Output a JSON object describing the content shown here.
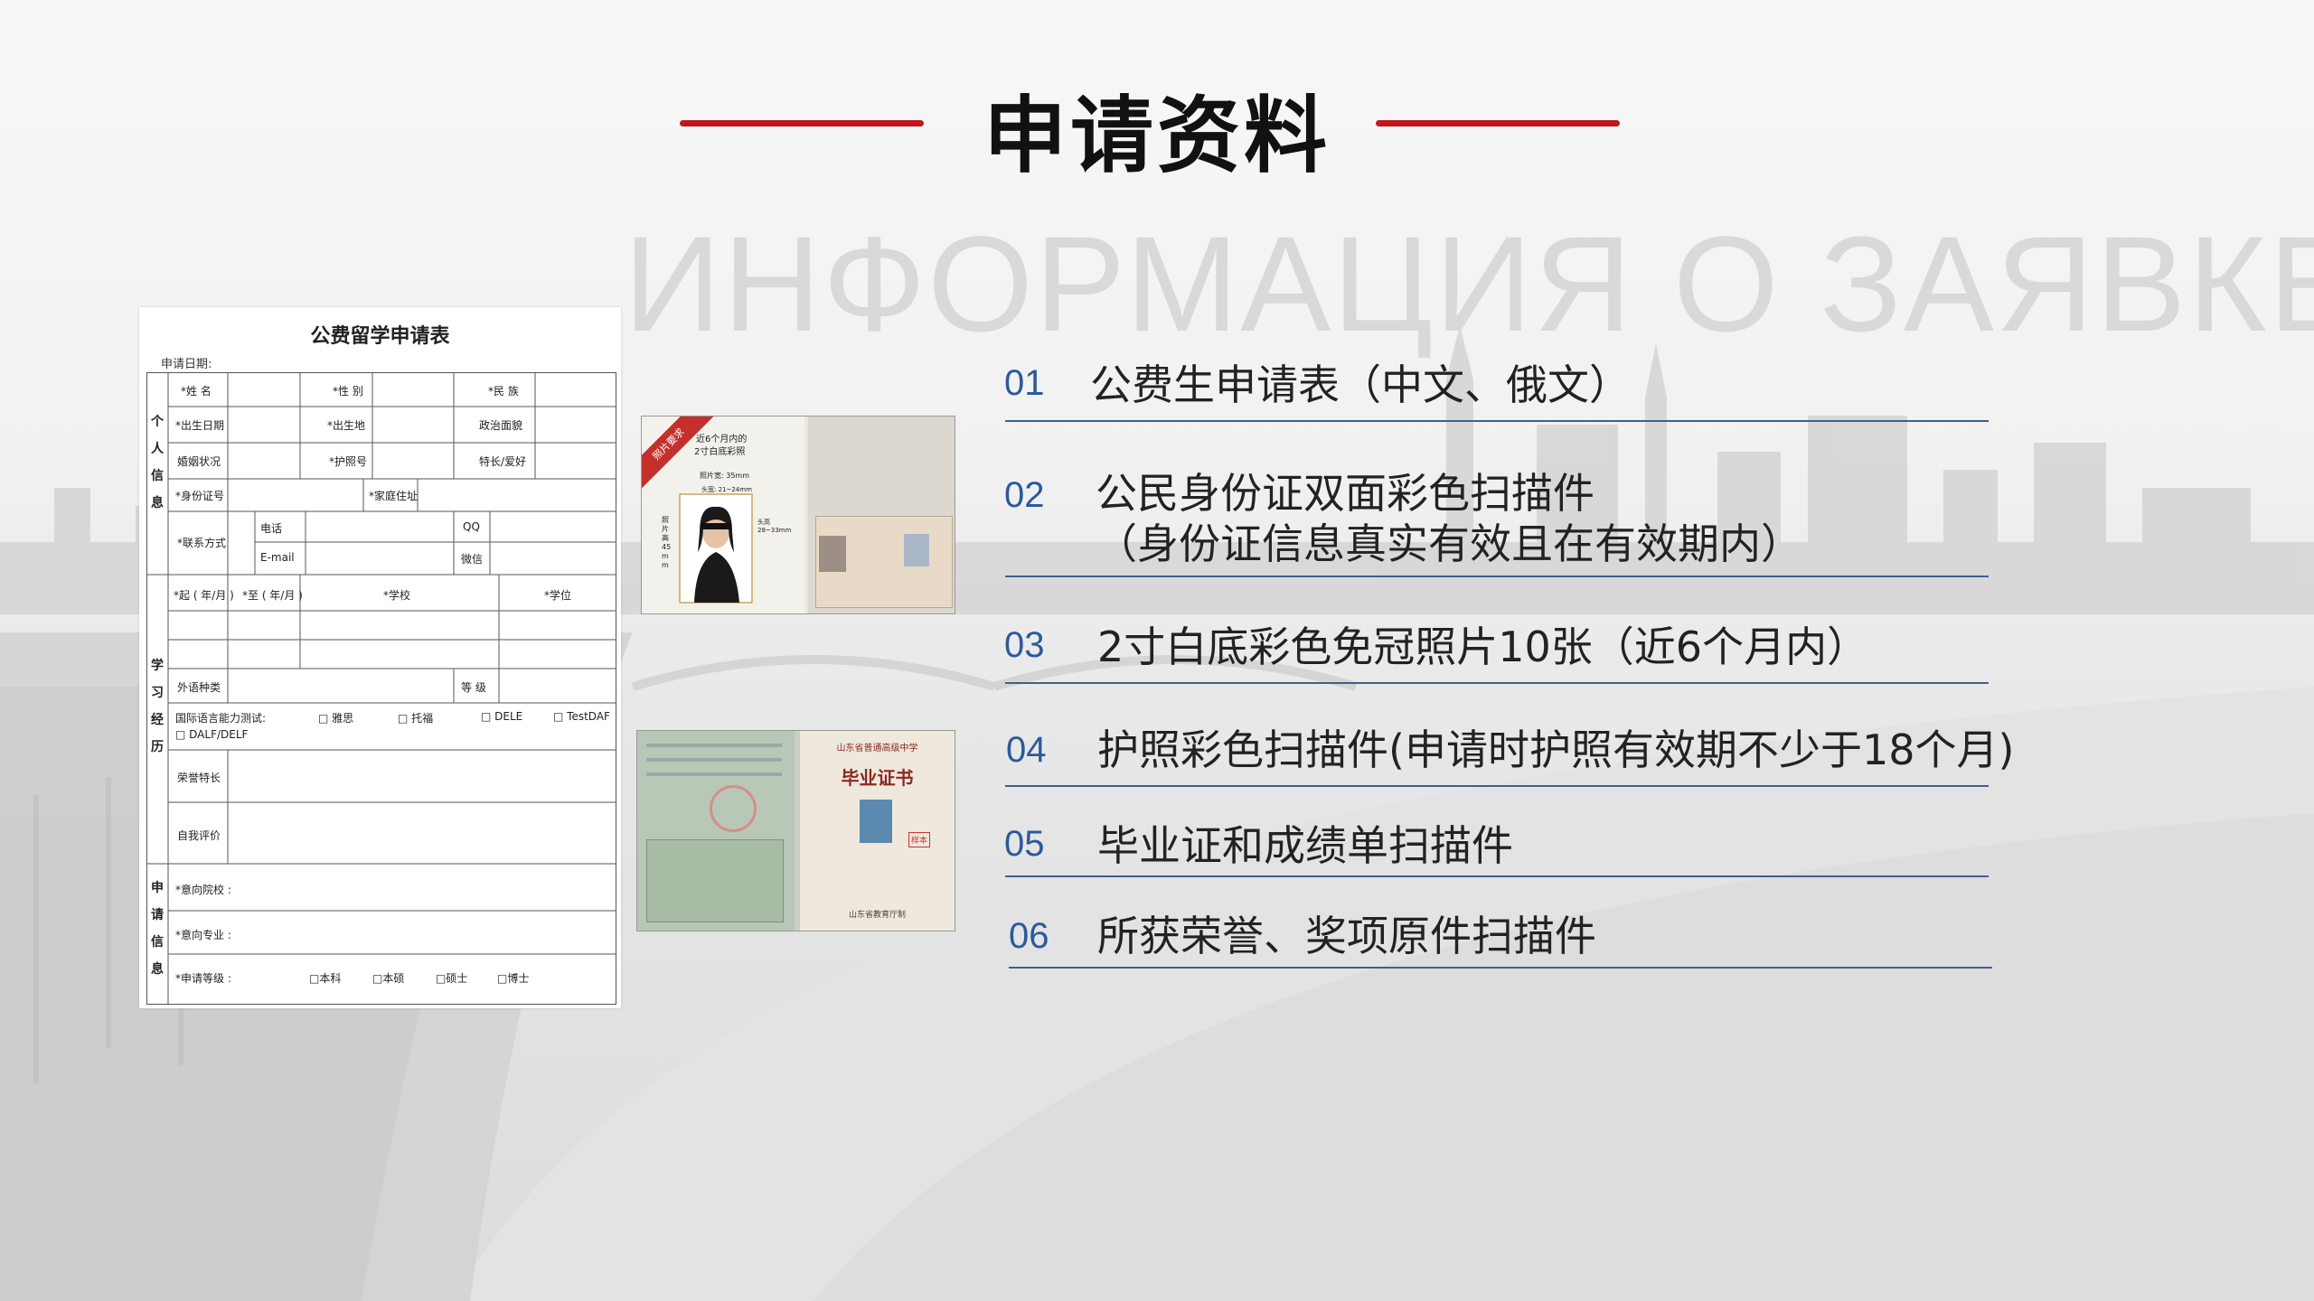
{
  "slide": {
    "title": "申请资料",
    "background_text": "ИНФОРМАЦИЯ О ЗАЯВКЕ"
  },
  "colors": {
    "accent": "#c0161c",
    "number": "#2b5a9c",
    "separator": "#3d5f8f"
  },
  "form": {
    "title": "公费留学申请表",
    "date_label": "申请日期:",
    "sections": [
      "个人信息",
      "学习经历",
      "申请信息"
    ],
    "personal": {
      "name": "*姓 名",
      "gender": "*性 别",
      "ethnicity": "*民 族",
      "birth_date": "*出生日期",
      "birthplace": "*出生地",
      "political": "政治面貌",
      "marital": "婚姻状况",
      "passport": "*护照号",
      "hobby": "特长/爱好",
      "id_number": "*身份证号",
      "address": "*家庭住址",
      "contact": "*联系方式",
      "phone": "电话",
      "qq": "QQ",
      "email": "E-mail",
      "wechat": "微信"
    },
    "study": {
      "from": "*起 ( 年/月 )",
      "to": "*至 ( 年/月 )",
      "school": "*学校",
      "degree": "*学位",
      "language": "外语种类",
      "level": "等 级",
      "test_label": "国际语言能力测试:",
      "tests": [
        "□ 雅思",
        "□ 托福",
        "□ DELE",
        "□ TestDAF",
        "□ DALF/DELF"
      ],
      "honors": "荣誉特长",
      "self_eval": "自我评价"
    },
    "apply": {
      "school": "*意向院校 :",
      "major": "*意向专业 :",
      "level": "*申请等级 :",
      "options": [
        "□本科",
        "□本硕",
        "□硕士",
        "□博士"
      ]
    }
  },
  "photo1": {
    "ribbon": "照片要求",
    "caption1": "近6个月内的",
    "caption2": "2寸白底彩照",
    "width_label": "照片宽: 35mm",
    "face_width": "头宽: 21~24mm",
    "height_label": "照片高45mm",
    "head_height": "头高 28~33mm"
  },
  "photo2": {
    "school": "山东省普通高级中学",
    "cert": "毕业证书",
    "stamp": "样本",
    "issuer": "山东省教育厅制"
  },
  "items": [
    {
      "num": "01",
      "lines": [
        "公费生申请表（中文、俄文）"
      ]
    },
    {
      "num": "02",
      "lines": [
        "公民身份证双面彩色扫描件",
        "（身份证信息真实有效且在有效期内）"
      ]
    },
    {
      "num": "03",
      "lines": [
        "2寸白底彩色免冠照片10张（近6个月内）"
      ]
    },
    {
      "num": "04",
      "lines": [
        "护照彩色扫描件(申请时护照有效期不少于18个月)"
      ]
    },
    {
      "num": "05",
      "lines": [
        "毕业证和成绩单扫描件"
      ]
    },
    {
      "num": "06",
      "lines": [
        "所获荣誉、奖项原件扫描件"
      ]
    }
  ]
}
